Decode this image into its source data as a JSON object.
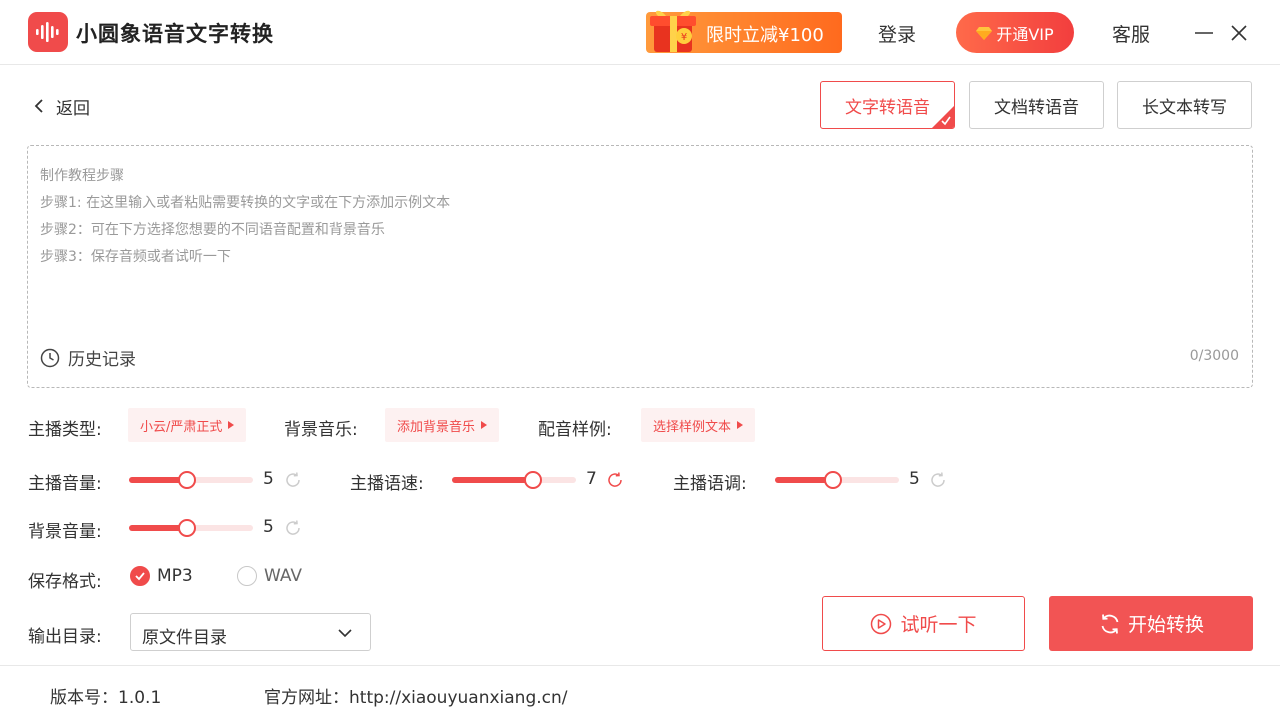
{
  "app": {
    "title": "小圆象语音文字转换",
    "promo_text": "限时立减¥100",
    "login": "登录",
    "vip": "开通VIP",
    "support": "客服",
    "colors": {
      "accent": "#f04b4b",
      "promo": "#ff7a28"
    }
  },
  "nav": {
    "back": "返回",
    "tabs": [
      {
        "label": "文字转语音",
        "active": true
      },
      {
        "label": "文档转语音",
        "active": false
      },
      {
        "label": "长文本转写",
        "active": false
      }
    ]
  },
  "editor": {
    "placeholder_lines": [
      "制作教程步骤",
      "步骤1:  在这里输入或者粘贴需要转换的文字或在下方添加示例文本",
      "步骤2：可在下方选择您想要的不同语音配置和背景音乐",
      "步骤3：保存音频或者试听一下"
    ],
    "history": "历史记录",
    "char_count": "0/3000"
  },
  "options": {
    "anchor_type_label": "主播类型:",
    "anchor_type_value": "小云/严肃正式",
    "bgm_label": "背景音乐:",
    "bgm_value": "添加背景音乐",
    "sample_label": "配音样例:",
    "sample_value": "选择样例文本"
  },
  "sliders": {
    "volume": {
      "label": "主播音量:",
      "value": "5",
      "fraction": 0.47
    },
    "speed": {
      "label": "主播语速:",
      "value": "7",
      "fraction": 0.65
    },
    "pitch": {
      "label": "主播语调:",
      "value": "5",
      "fraction": 0.47
    },
    "bgm_volume": {
      "label": "背景音量:",
      "value": "5",
      "fraction": 0.47
    }
  },
  "format": {
    "label": "保存格式:",
    "options": [
      {
        "label": "MP3",
        "selected": true
      },
      {
        "label": "WAV",
        "selected": false
      }
    ]
  },
  "output": {
    "label": "输出目录:",
    "value": "原文件目录"
  },
  "actions": {
    "preview": "试听一下",
    "convert": "开始转换"
  },
  "footer": {
    "version": "版本号：1.0.1",
    "website": "官方网址：http://xiaouyuanxiang.cn/"
  }
}
